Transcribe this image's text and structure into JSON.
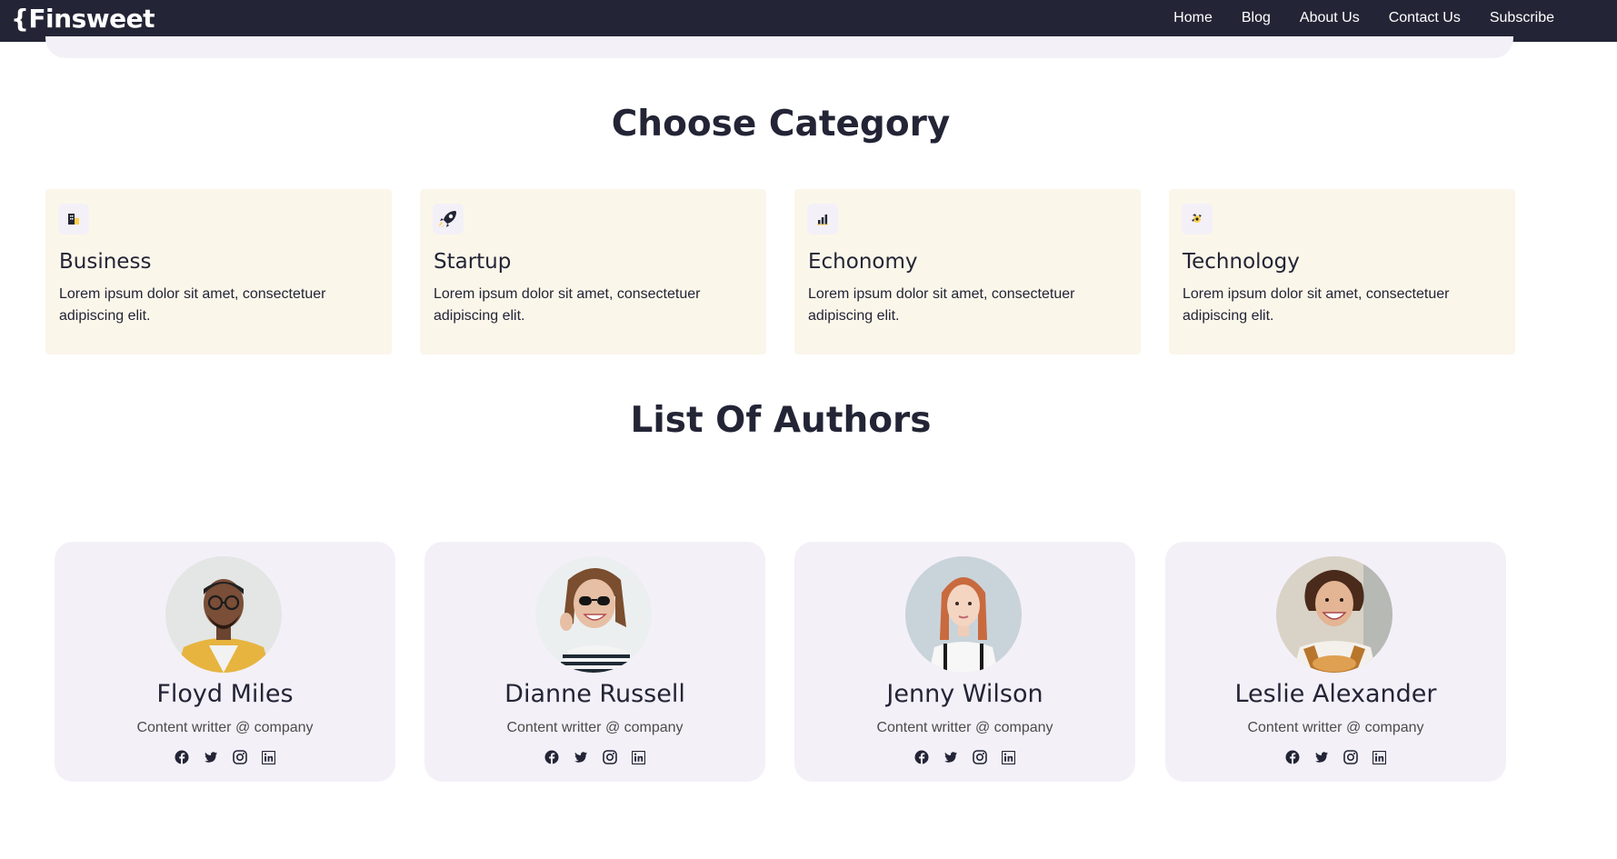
{
  "brand": {
    "logo": "{Finsweet"
  },
  "nav": {
    "items": [
      "Home",
      "Blog",
      "About Us",
      "Contact Us",
      "Subscribe"
    ]
  },
  "sections": {
    "categories_title": "Choose Category",
    "authors_title": "List Of Authors"
  },
  "categories": [
    {
      "name": "Business",
      "description": "Lorem ipsum dolor sit amet, consectetuer adipiscing elit.",
      "icon": "business-icon"
    },
    {
      "name": "Startup",
      "description": "Lorem ipsum dolor sit amet, consectetuer adipiscing elit.",
      "icon": "rocket-icon"
    },
    {
      "name": "Echonomy",
      "description": "Lorem ipsum dolor sit amet, consectetuer adipiscing elit.",
      "icon": "chart-icon"
    },
    {
      "name": "Technology",
      "description": "Lorem ipsum dolor sit amet, consectetuer adipiscing elit.",
      "icon": "technology-icon"
    }
  ],
  "authors": [
    {
      "name": "Floyd Miles",
      "role": "Content writter @ company"
    },
    {
      "name": "Dianne Russell",
      "role": "Content writter @ company"
    },
    {
      "name": "Jenny Wilson",
      "role": "Content writter @ company"
    },
    {
      "name": "Leslie Alexander",
      "role": "Content writter @ company"
    }
  ],
  "social_icons": [
    "facebook-icon",
    "twitter-icon",
    "instagram-icon",
    "linkedin-icon"
  ],
  "colors": {
    "nav_bg": "#232536",
    "category_card_bg": "#fbf6ea",
    "author_card_bg": "#f4f0f8",
    "accent": "#ffd050",
    "text": "#232536"
  }
}
